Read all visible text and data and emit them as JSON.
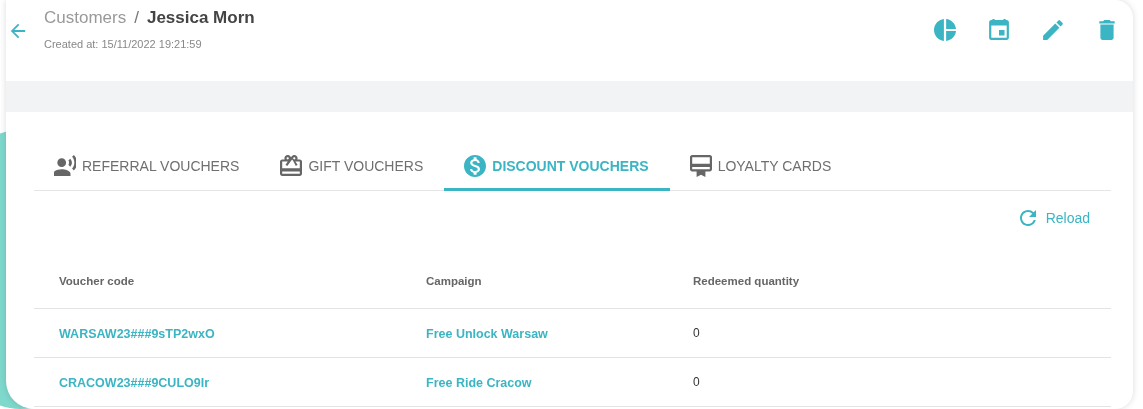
{
  "breadcrumb": {
    "parent": "Customers",
    "separator": "/",
    "current": "Jessica Morn"
  },
  "created_at": "Created at: 15/11/2022 19:21:59",
  "header_actions": [
    {
      "kind": "chart"
    },
    {
      "kind": "calendar"
    },
    {
      "kind": "edit"
    },
    {
      "kind": "delete"
    }
  ],
  "tabs": [
    {
      "label": "REFERRAL VOUCHERS",
      "kind": "referral",
      "selected": false
    },
    {
      "label": "GIFT VOUCHERS",
      "kind": "gift",
      "selected": false
    },
    {
      "label": "DISCOUNT VOUCHERS",
      "kind": "discount",
      "selected": true
    },
    {
      "label": "LOYALTY CARDS",
      "kind": "loyalty",
      "selected": false
    }
  ],
  "reload": "Reload",
  "table": {
    "columns": [
      "Voucher code",
      "Campaign",
      "Redeemed quantity"
    ],
    "rows": [
      {
        "voucher_code": "WARSAW23###9sTP2wxO",
        "campaign": "Free Unlock Warsaw",
        "redeemed_quantity": "0"
      },
      {
        "voucher_code": "CRACOW23###9CULO9Ir",
        "campaign": "Free Ride Cracow",
        "redeemed_quantity": "0"
      }
    ]
  }
}
